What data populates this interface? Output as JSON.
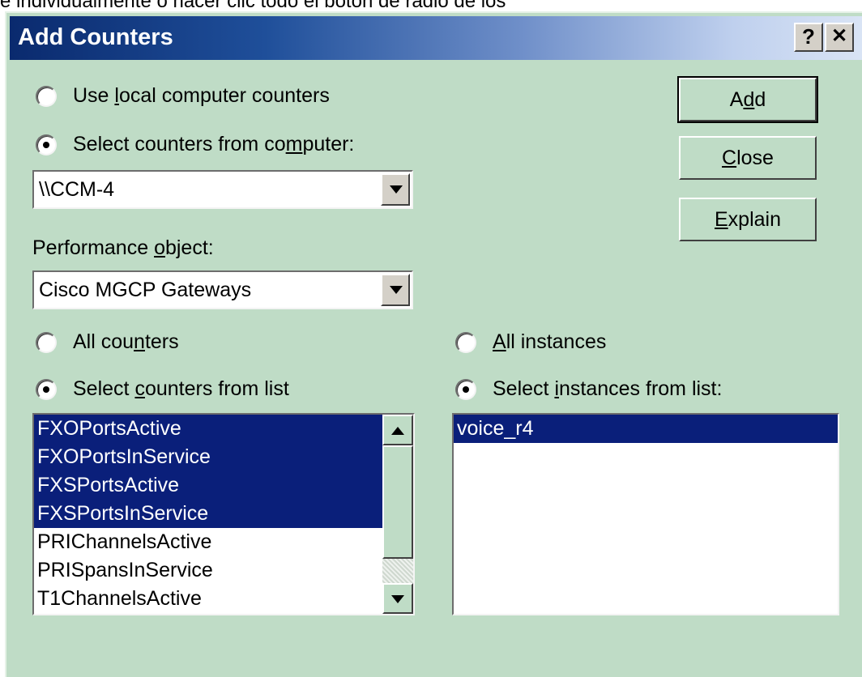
{
  "caption": "e individualmente o hacer clic todo el botón de radio de los",
  "dialog": {
    "title": "Add Counters",
    "help_button": "?",
    "close_button": "✕"
  },
  "computer": {
    "use_local_label": "Use local computer counters",
    "select_from_label": "Select counters from computer:",
    "computer_value": "\\\\CCM-4",
    "use_local_checked": false,
    "select_from_checked": true
  },
  "performance_object": {
    "label": "Performance object:",
    "value": "Cisco MGCP Gateways"
  },
  "counters": {
    "all_label": "All counters",
    "select_label": "Select counters from list",
    "items": [
      {
        "label": "FXOPortsActive",
        "selected": true
      },
      {
        "label": "FXOPortsInService",
        "selected": true
      },
      {
        "label": "FXSPortsActive",
        "selected": true
      },
      {
        "label": "FXSPortsInService",
        "selected": true
      },
      {
        "label": "PRIChannelsActive",
        "selected": false
      },
      {
        "label": "PRISpansInService",
        "selected": false
      },
      {
        "label": "T1ChannelsActive",
        "selected": false
      }
    ]
  },
  "instances": {
    "all_label": "All instances",
    "select_label": "Select instances from list:",
    "items": [
      {
        "label": "voice_r4",
        "selected": true
      }
    ]
  },
  "buttons": {
    "add": "Add",
    "close": "Close",
    "explain": "Explain"
  },
  "colors": {
    "dialog_bg": "#bfdcc6",
    "selection": "#0a1f7a",
    "title_start": "#0a2a6e"
  }
}
